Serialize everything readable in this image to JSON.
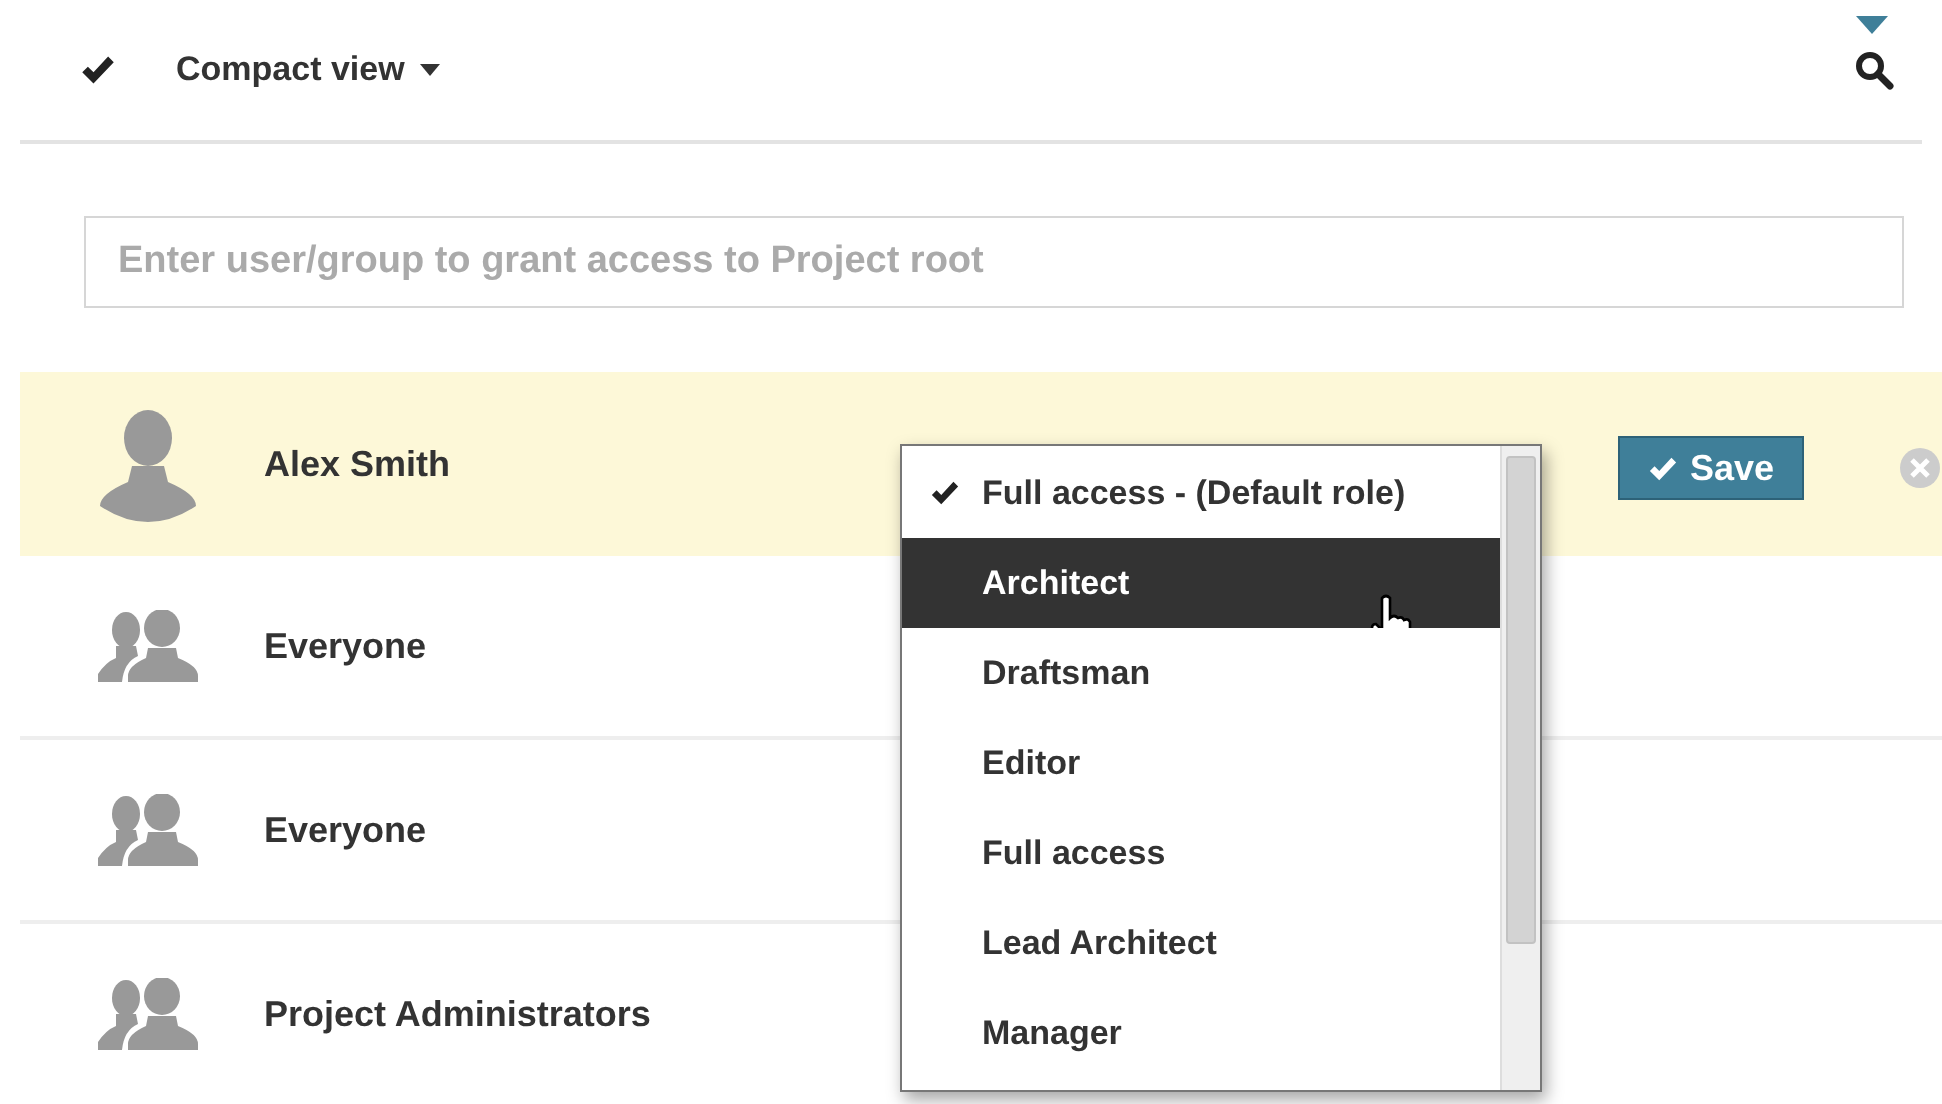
{
  "toolbar": {
    "view_label": "Compact view"
  },
  "search": {
    "placeholder": "Enter user/group to grant access to Project root"
  },
  "rows": [
    {
      "name": "Alex Smith",
      "kind": "user",
      "selected": true
    },
    {
      "name": "Everyone",
      "kind": "group",
      "selected": false
    },
    {
      "name": "Everyone",
      "kind": "group",
      "selected": false
    },
    {
      "name": "Project Administrators",
      "kind": "group",
      "selected": false
    }
  ],
  "save_button": "Save",
  "role_menu": {
    "items": [
      {
        "label": "Full access - (Default role)",
        "selected": true,
        "hovered": false
      },
      {
        "label": "Architect",
        "selected": false,
        "hovered": true
      },
      {
        "label": "Draftsman",
        "selected": false,
        "hovered": false
      },
      {
        "label": "Editor",
        "selected": false,
        "hovered": false
      },
      {
        "label": "Full access",
        "selected": false,
        "hovered": false
      },
      {
        "label": "Lead Architect",
        "selected": false,
        "hovered": false
      },
      {
        "label": "Manager",
        "selected": false,
        "hovered": false
      }
    ]
  }
}
